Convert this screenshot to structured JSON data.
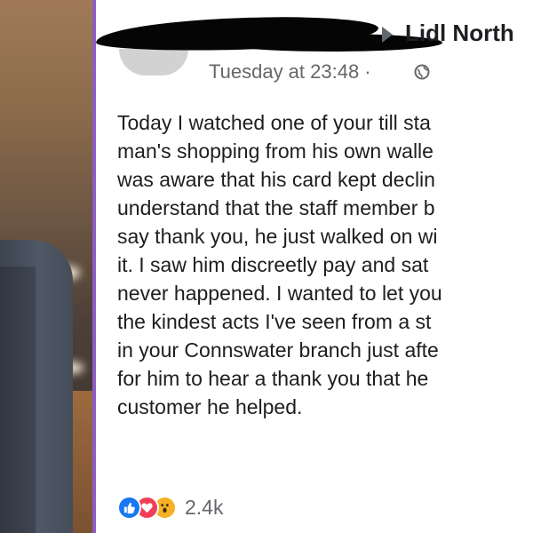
{
  "post": {
    "page_name": "Lidl North",
    "timestamp": "Tuesday at 23:48 ·",
    "body_lines": [
      "Today I watched one of your till sta",
      "man's shopping from his own walle",
      "was aware that his card kept declin",
      "understand that the staff member b",
      "say thank you, he just walked on wi",
      "it. I saw him discreetly pay and sat",
      "never happened. I wanted to let you",
      "the kindest acts I've seen from a st",
      "in your Connswater branch just afte",
      "for him to hear a thank you that he",
      "customer he helped."
    ],
    "reactions": {
      "icons": [
        "like-icon",
        "love-icon",
        "wow-icon"
      ],
      "count": "2.4k"
    }
  },
  "colors": {
    "divider": "#8d5cc4",
    "like": "#1877f2",
    "love": "#f33e58",
    "wow": "#f7b125"
  }
}
